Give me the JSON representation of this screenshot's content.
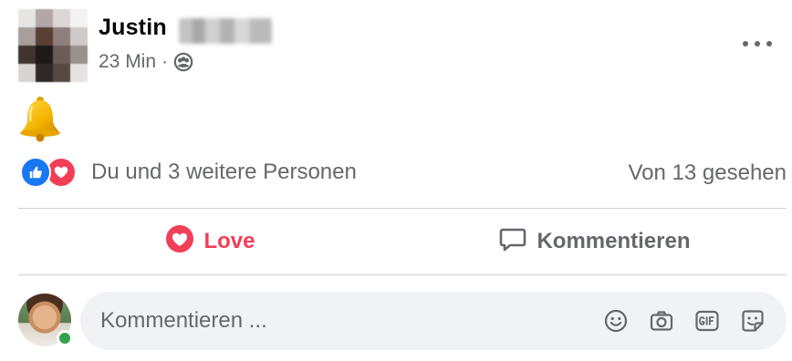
{
  "post": {
    "author_name": "Justin",
    "time": "23 Min",
    "separator": "·",
    "audience_icon": "friends-icon",
    "more_icon": "more-horizontal-icon",
    "content_emoji": "🔔"
  },
  "reactions": {
    "types": [
      "like-icon",
      "love-icon"
    ],
    "summary": "Du und 3 weitere Personen",
    "seen": "Von 13 gesehen"
  },
  "actions": {
    "love_label": "Love",
    "comment_label": "Kommentieren"
  },
  "composer": {
    "placeholder": "Kommentieren ...",
    "icons": [
      "emoji-icon",
      "camera-icon",
      "gif-icon",
      "sticker-icon"
    ]
  },
  "colors": {
    "love": "#f33e58",
    "like": "#1877f2",
    "secondary_text": "#65676b",
    "divider": "#ced0d4",
    "composer_bg": "#f0f2f5",
    "online": "#31a24c"
  }
}
